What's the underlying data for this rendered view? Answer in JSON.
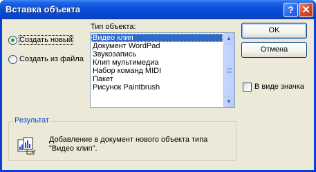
{
  "window": {
    "title": "Вставка объекта",
    "help_glyph": "?",
    "close_glyph": "✕"
  },
  "source_options": {
    "create_new": {
      "label": "Создать новый",
      "selected": true
    },
    "create_from_file": {
      "label": "Создать из файла",
      "selected": false
    }
  },
  "object_type": {
    "label": "Тип объекта:",
    "items": [
      "Видео клип",
      "Документ WordPad",
      "Звукозапись",
      "Клип мультимедиа",
      "Набор команд MIDI",
      "Пакет",
      "Рисунок Paintbrush"
    ],
    "selected_index": 0
  },
  "buttons": {
    "ok": "OK",
    "cancel": "Отмена"
  },
  "display_as_icon": {
    "label": "В виде значка",
    "checked": false
  },
  "result": {
    "title": "Результат",
    "text_line1": "Добавление в документ нового объекта типа",
    "text_line2": "\"Видео клип\"."
  },
  "icons": {
    "help": "help-icon",
    "close": "close-icon",
    "scroll_up": "arrow-up-icon",
    "scroll_down": "arrow-down-icon",
    "result": "insert-object-icon"
  },
  "colors": {
    "titlebar": "#0a4fd9",
    "face": "#ece9d8",
    "selection": "#316ac5",
    "group_title": "#0046d5"
  }
}
